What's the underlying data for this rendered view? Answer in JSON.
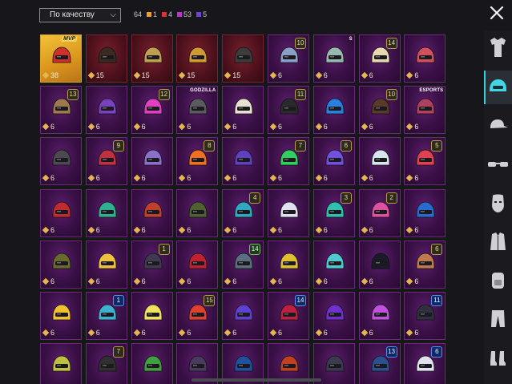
{
  "sort": {
    "label": "По качеству"
  },
  "counts": {
    "total": "64",
    "items": [
      {
        "color": "#f0a020",
        "value": "1"
      },
      {
        "color": "#e03040",
        "value": "4"
      },
      {
        "color": "#c030d0",
        "value": "53"
      },
      {
        "color": "#7040e0",
        "value": "5"
      }
    ]
  },
  "colors": {
    "accent": "#36d0e0",
    "legendary": "#f0a020",
    "mythic": "#e03040",
    "epic": "#c030d0"
  },
  "tiles": [
    {
      "rarity": "gold",
      "qty": "38",
      "tag": "MVP",
      "helm": "#d0302a"
    },
    {
      "rarity": "red",
      "qty": "15",
      "helm": "#3a2a22"
    },
    {
      "rarity": "red",
      "qty": "15",
      "helm": "#c0a050"
    },
    {
      "rarity": "red",
      "qty": "15",
      "helm": "#d09a30"
    },
    {
      "rarity": "red",
      "qty": "15",
      "helm": "#3c3c3a"
    },
    {
      "rarity": "epic",
      "qty": "6",
      "lvl": "10",
      "helm": "#8aa0c8"
    },
    {
      "rarity": "epic",
      "qty": "6",
      "tag": "S",
      "helm": "#98b8b0"
    },
    {
      "rarity": "epic",
      "qty": "6",
      "lvl": "14",
      "helm": "#e8d8b0"
    },
    {
      "rarity": "epic",
      "qty": "6",
      "helm": "#d05060"
    },
    {
      "rarity": "epic",
      "qty": "6",
      "lvl": "13",
      "helm": "#a07850"
    },
    {
      "rarity": "epic",
      "qty": "6",
      "helm": "#7a40c0"
    },
    {
      "rarity": "epic",
      "qty": "6",
      "lvl": "12",
      "helm": "#e040c0"
    },
    {
      "rarity": "epic",
      "qty": "6",
      "tag": "GODZILLA",
      "helm": "#5a5a60"
    },
    {
      "rarity": "epic",
      "qty": "6",
      "helm": "#e8e0d0"
    },
    {
      "rarity": "epic",
      "qty": "6",
      "lvl": "11",
      "helm": "#2a2a2c"
    },
    {
      "rarity": "epic",
      "qty": "6",
      "helm": "#2a80e0"
    },
    {
      "rarity": "epic",
      "qty": "6",
      "lvl": "10",
      "helm": "#5a3a2a"
    },
    {
      "rarity": "epic",
      "qty": "6",
      "tag": "ESPORTS",
      "helm": "#b04060"
    },
    {
      "rarity": "epic",
      "qty": "6",
      "helm": "#4a4a50"
    },
    {
      "rarity": "epic",
      "qty": "6",
      "lvl": "9",
      "helm": "#c03040"
    },
    {
      "rarity": "epic",
      "qty": "6",
      "helm": "#8a70c8"
    },
    {
      "rarity": "epic",
      "qty": "6",
      "lvl": "8",
      "helm": "#f07020"
    },
    {
      "rarity": "epic",
      "qty": "6",
      "helm": "#6040c0"
    },
    {
      "rarity": "epic",
      "qty": "6",
      "lvl": "7",
      "helm": "#30d060"
    },
    {
      "rarity": "epic",
      "qty": "6",
      "lvl": "6",
      "helm": "#7050e0"
    },
    {
      "rarity": "epic",
      "qty": "6",
      "helm": "#d8e4f0"
    },
    {
      "rarity": "epic",
      "qty": "6",
      "lvl": "5",
      "helm": "#e04050"
    },
    {
      "rarity": "epic",
      "qty": "6",
      "helm": "#c02a30"
    },
    {
      "rarity": "epic",
      "qty": "6",
      "helm": "#30b090"
    },
    {
      "rarity": "epic",
      "qty": "6",
      "helm": "#c04030"
    },
    {
      "rarity": "epic",
      "qty": "6",
      "helm": "#506030"
    },
    {
      "rarity": "epic",
      "qty": "6",
      "lvl": "4",
      "helm": "#30a8c0"
    },
    {
      "rarity": "epic",
      "qty": "6",
      "helm": "#e0e0f0"
    },
    {
      "rarity": "epic",
      "qty": "6",
      "lvl": "3",
      "helm": "#30c0b0"
    },
    {
      "rarity": "epic",
      "qty": "6",
      "lvl": "2",
      "helm": "#e050a0"
    },
    {
      "rarity": "epic",
      "qty": "6",
      "helm": "#2a6ad0"
    },
    {
      "rarity": "epic",
      "qty": "6",
      "helm": "#6a6a30"
    },
    {
      "rarity": "epic",
      "qty": "6",
      "helm": "#f0c040"
    },
    {
      "rarity": "epic",
      "qty": "6",
      "lvl": "1",
      "helm": "#403a50"
    },
    {
      "rarity": "epic",
      "qty": "6",
      "helm": "#c02030"
    },
    {
      "rarity": "epic",
      "qty": "6",
      "lvl": "14",
      "lvlStyle": "green",
      "helm": "#5a7080"
    },
    {
      "rarity": "epic",
      "qty": "6",
      "helm": "#e0c030"
    },
    {
      "rarity": "epic",
      "qty": "6",
      "helm": "#50c8d0"
    },
    {
      "rarity": "epic",
      "qty": "6",
      "helm": "#1a1a2a"
    },
    {
      "rarity": "epic",
      "qty": "6",
      "lvl": "6",
      "helm": "#c07a50"
    },
    {
      "rarity": "epic",
      "qty": "6",
      "helm": "#f0c030"
    },
    {
      "rarity": "epic",
      "qty": "6",
      "lvl": "1",
      "lvlStyle": "blue",
      "helm": "#40b0d0"
    },
    {
      "rarity": "epic",
      "qty": "6",
      "helm": "#f0e060"
    },
    {
      "rarity": "epic",
      "qty": "6",
      "lvl": "15",
      "helm": "#e04030"
    },
    {
      "rarity": "epic",
      "qty": "6",
      "helm": "#6040d0"
    },
    {
      "rarity": "epic",
      "qty": "6",
      "lvl": "14",
      "lvlStyle": "blue",
      "helm": "#c02040"
    },
    {
      "rarity": "epic",
      "qty": "6",
      "helm": "#7030d0"
    },
    {
      "rarity": "epic",
      "qty": "6",
      "helm": "#c050e0"
    },
    {
      "rarity": "epic",
      "qty": "6",
      "lvl": "11",
      "lvlStyle": "blue",
      "helm": "#303040"
    },
    {
      "rarity": "epic",
      "qty": "",
      "helm": "#c0c040"
    },
    {
      "rarity": "epic",
      "qty": "",
      "lvl": "7",
      "helm": "#303030"
    },
    {
      "rarity": "epic",
      "qty": "",
      "helm": "#40a040"
    },
    {
      "rarity": "epic",
      "qty": "",
      "helm": "#4a3a60"
    },
    {
      "rarity": "epic",
      "qty": "",
      "helm": "#2050a0"
    },
    {
      "rarity": "epic",
      "qty": "",
      "helm": "#c04020"
    },
    {
      "rarity": "epic",
      "qty": "",
      "helm": "#3a3a50"
    },
    {
      "rarity": "epic",
      "qty": "",
      "lvl": "13",
      "lvlStyle": "blue",
      "helm": "#2a5090"
    },
    {
      "rarity": "epic",
      "qty": "",
      "lvl": "6",
      "lvlStyle": "blue",
      "helm": "#e0e0f0"
    }
  ],
  "sidebar": {
    "items": [
      {
        "name": "sidebar-outfit",
        "icon": "outfit-icon"
      },
      {
        "name": "sidebar-helmet",
        "icon": "helmet-icon",
        "active": true
      },
      {
        "name": "sidebar-hat",
        "icon": "cap-icon"
      },
      {
        "name": "sidebar-glasses",
        "icon": "glasses-icon"
      },
      {
        "name": "sidebar-mask",
        "icon": "mask-icon"
      },
      {
        "name": "sidebar-jacket",
        "icon": "jacket-icon"
      },
      {
        "name": "sidebar-backpack",
        "icon": "backpack-icon"
      },
      {
        "name": "sidebar-pants",
        "icon": "pants-icon"
      },
      {
        "name": "sidebar-shoes",
        "icon": "shoes-icon"
      }
    ]
  }
}
